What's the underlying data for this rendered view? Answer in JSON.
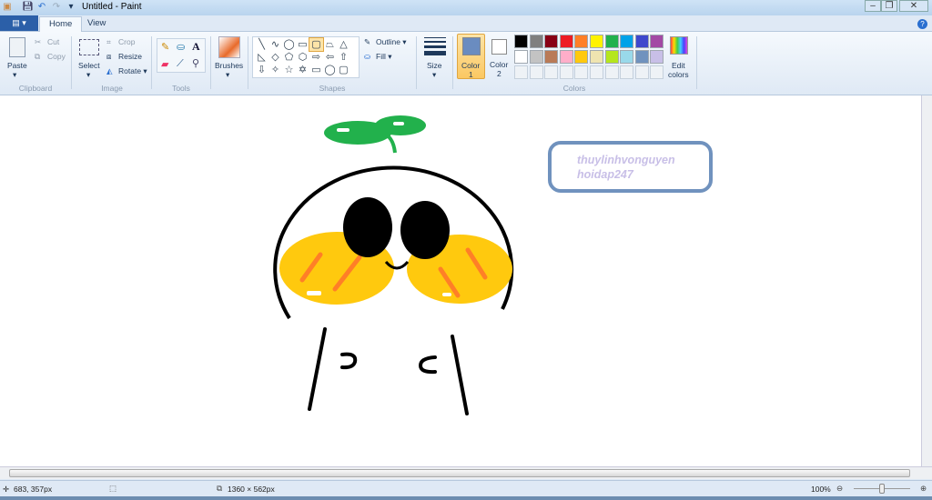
{
  "window": {
    "title": "Untitled - Paint"
  },
  "tabs": {
    "file": "▤ ▾",
    "home": "Home",
    "view": "View"
  },
  "clipboard": {
    "group": "Clipboard",
    "paste": "Paste",
    "cut": "Cut",
    "copy": "Copy"
  },
  "image": {
    "group": "Image",
    "select": "Select",
    "crop": "Crop",
    "resize": "Resize",
    "rotate": "Rotate ▾"
  },
  "tools": {
    "group": "Tools"
  },
  "brushes": {
    "label": "Brushes"
  },
  "shapes": {
    "group": "Shapes",
    "outline": "Outline ▾",
    "fill": "Fill ▾",
    "glyphs": [
      "╲",
      "∿",
      "◯",
      "▭",
      "▢",
      "⏢",
      "△",
      "◺",
      "◇",
      "⬠",
      "⬡",
      "⇨",
      "⇦",
      "⇧",
      "⇩",
      "✧",
      "☆",
      "✡",
      "▭",
      "◯",
      "▢"
    ]
  },
  "size": {
    "label": "Size"
  },
  "colors": {
    "group": "Colors",
    "color1": "Color",
    "color1_num": "1",
    "color2": "Color",
    "color2_num": "2",
    "edit": "Edit",
    "edit2": "colors",
    "color1_value": "#6a8cc0",
    "color2_value": "#ffffff",
    "palette_row1": [
      "#000000",
      "#7f7f7f",
      "#880015",
      "#ed1c24",
      "#ff7f27",
      "#fff200",
      "#22b14c",
      "#00a2e8",
      "#3f48cc",
      "#a349a4"
    ],
    "palette_row2": [
      "#ffffff",
      "#c3c3c3",
      "#b97a57",
      "#ffaec9",
      "#ffc90e",
      "#efe4b0",
      "#b5e61d",
      "#99d9ea",
      "#7092be",
      "#c8bfe7"
    ]
  },
  "drawing": {
    "watermark_line1": "thuylinhvonguyen",
    "watermark_line2": "hoidap247"
  },
  "status": {
    "cursor": "683, 357px",
    "size": "1360 × 562px",
    "zoom": "100%"
  }
}
